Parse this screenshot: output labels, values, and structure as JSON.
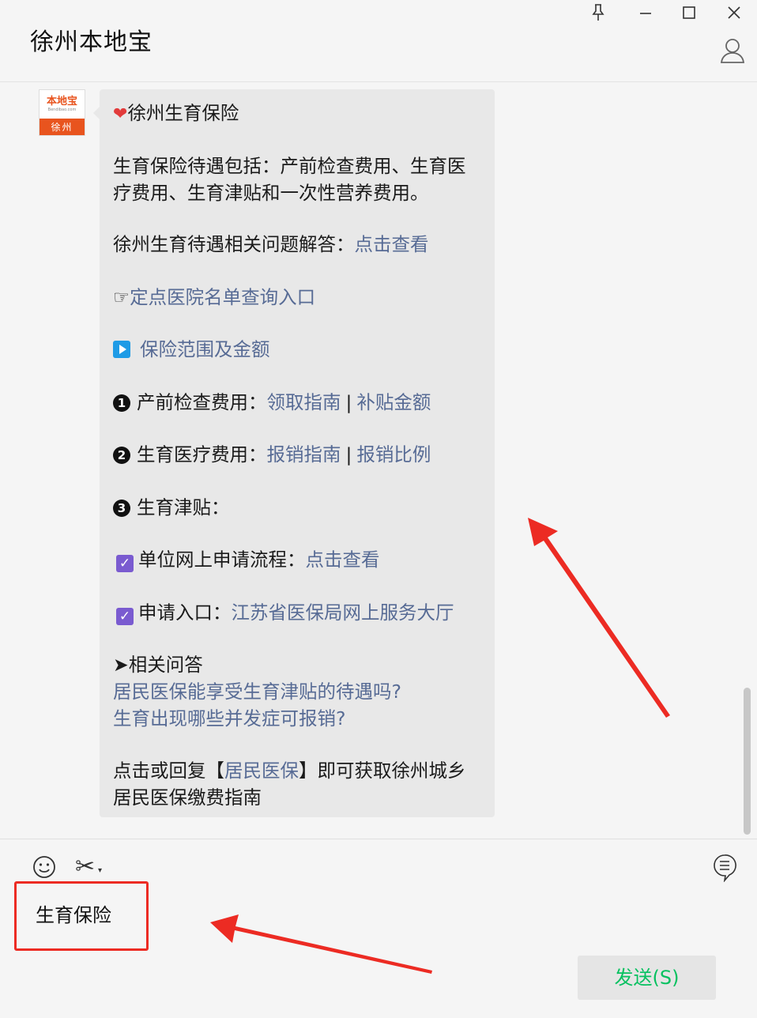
{
  "window": {
    "title": "徐州本地宝"
  },
  "account": {
    "avatar_brand": "本地宝",
    "avatar_domain": "Bendibao.com",
    "avatar_city": "徐州"
  },
  "message": {
    "heading": "徐州生育保险",
    "intro_line1": "生育保险待遇包括：产前检查费用、生育医",
    "intro_line2": "疗费用、生育津贴和一次性营养费用。",
    "qa_prefix": "徐州生育待遇相关问题解答：",
    "qa_link": "点击查看",
    "hospital_prefix": "☞",
    "hospital_link": "定点医院名单查询入口",
    "scope_link": "保险范围及金额",
    "item1_num": "1",
    "item1_label": "产前检查费用：",
    "item1_link1": "领取指南",
    "sep": "|",
    "item1_link2": "补贴金额",
    "item2_num": "2",
    "item2_label": "生育医疗费用：",
    "item2_link1": "报销指南",
    "item2_link2": "报销比例",
    "item3_num": "3",
    "item3_label": "生育津贴：",
    "apply_flow_label": "单位网上申请流程：",
    "apply_flow_link": "点击查看",
    "apply_entry_label": "申请入口：",
    "apply_entry_link": "江苏省医保局网上服务大厅",
    "related_prefix": "➤",
    "related_title": "相关问答",
    "related_q1": "居民医保能享受生育津贴的待遇吗?",
    "related_q2": "生育出现哪些并发症可报销?",
    "reply_pre": "点击或回复【",
    "reply_link": "居民医保",
    "reply_post": "】即可获取徐州城乡",
    "reply_line2": "居民医保缴费指南"
  },
  "composer": {
    "input_value": "生育保险",
    "send_label": "发送(S)"
  },
  "icons": {
    "titlebar": [
      "pin-icon",
      "minimize-icon",
      "maximize-icon",
      "close-icon",
      "user-icon"
    ],
    "toolbar": [
      "emoji-icon",
      "scissors-icon",
      "chat-history-icon"
    ],
    "bubble": [
      "heart-icon",
      "play-icon",
      "checkbox-icon"
    ]
  },
  "colors": {
    "link": "#576b95",
    "send_text": "#07c160",
    "annotation_red": "#ec2b23",
    "bubble_bg": "#e8e8e8",
    "checkbox": "#7a5bd0",
    "play": "#1e9be6"
  }
}
